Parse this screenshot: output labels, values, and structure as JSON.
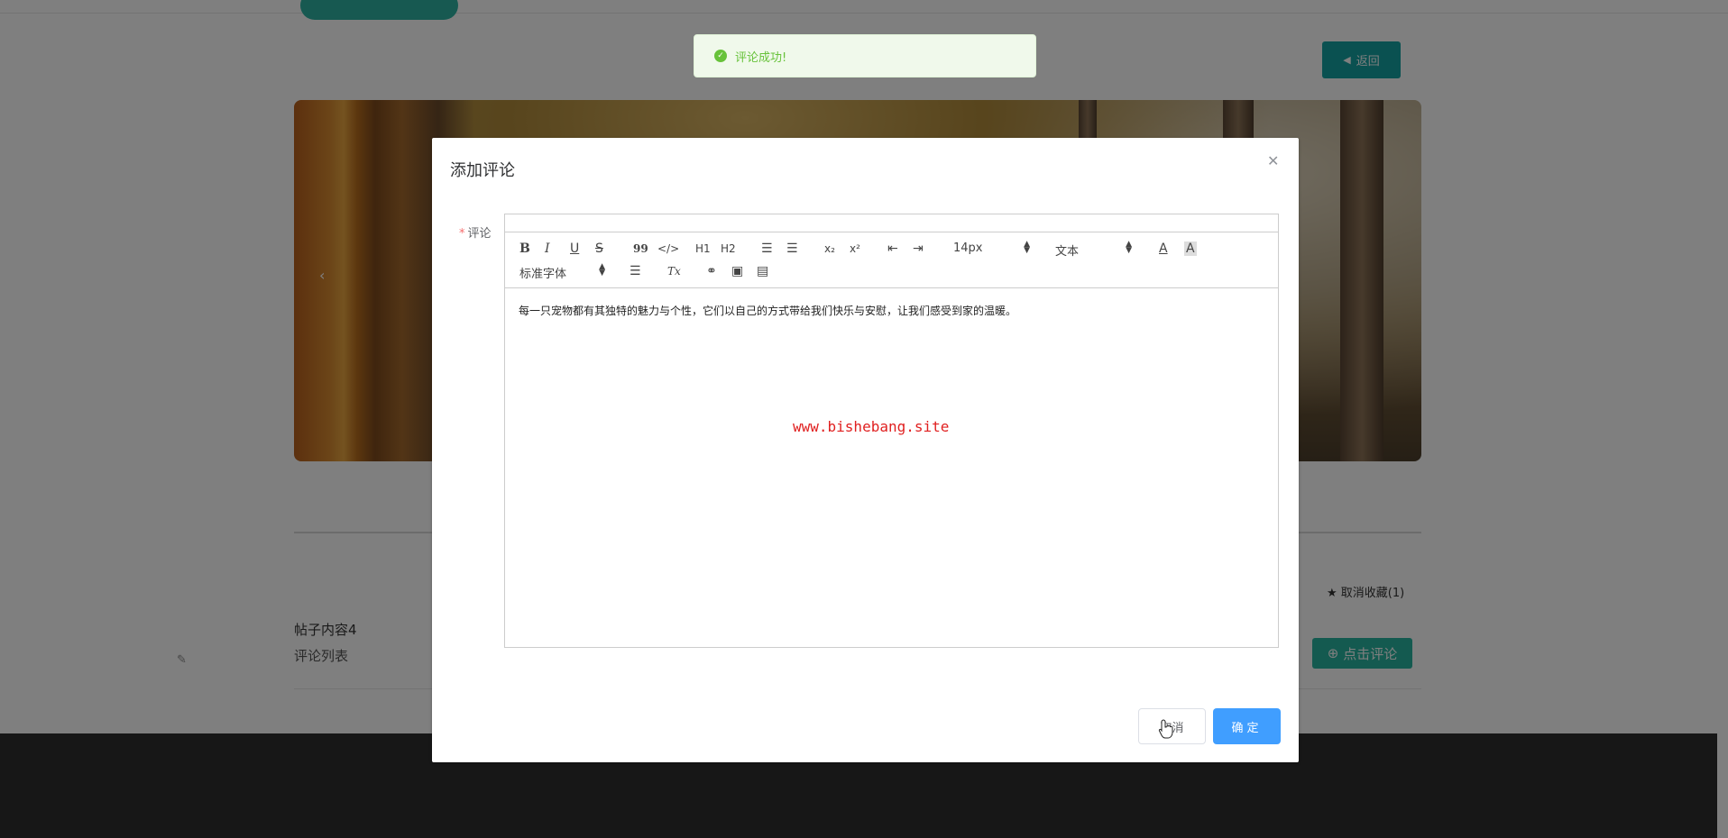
{
  "header": {
    "back_label": "返回"
  },
  "toast": {
    "message": "评论成功!"
  },
  "post": {
    "favorite_label": "取消收藏(1)",
    "title": "帖子内容4",
    "comment_list_label": "评论列表",
    "comment_button_label": "点击评论"
  },
  "dialog": {
    "title": "添加评论",
    "field_label": "评论",
    "required_mark": "*",
    "editor": {
      "toolbar": {
        "bold": "B",
        "italic": "I",
        "underline": "U",
        "strike": "S",
        "blockquote": "99",
        "code": "</>",
        "h1": "H1",
        "h2": "H2",
        "subscript": "x₂",
        "superscript": "x²",
        "font_size": "14px",
        "paragraph": "文本",
        "font_family": "标准字体",
        "clear_format": "Tx"
      },
      "content": "每一只宠物都有其独特的魅力与个性，它们以自己的方式带给我们快乐与安慰，让我们感受到家的温暖。"
    },
    "watermark": "www.bishebang.site",
    "cancel_label": "取消",
    "confirm_label": "确定"
  },
  "colors": {
    "primary": "#409eff",
    "success": "#67c23a",
    "teal": "#14a3a3"
  }
}
